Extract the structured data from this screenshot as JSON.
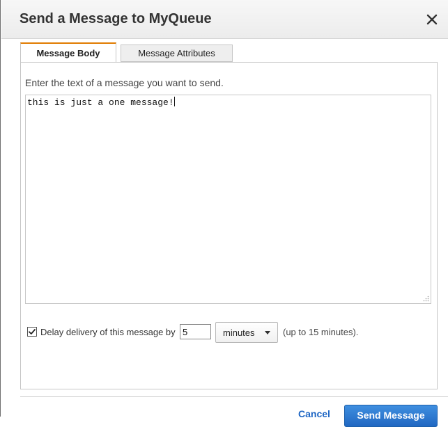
{
  "dialog": {
    "title": "Send a Message to MyQueue",
    "close_icon": "close-icon"
  },
  "tabs": [
    {
      "label": "Message Body",
      "active": true
    },
    {
      "label": "Message Attributes",
      "active": false
    }
  ],
  "body": {
    "instructions": "Enter the text of a message you want to send.",
    "message_text": "this is just a one message!"
  },
  "delay": {
    "checked": true,
    "label": "Delay delivery of this message by",
    "value": "5",
    "unit": "minutes",
    "hint": "(up to 15 minutes)."
  },
  "footer": {
    "cancel_label": "Cancel",
    "send_label": "Send Message"
  },
  "colors": {
    "accent_tab": "#e07b00",
    "primary_button": "#2067c2",
    "link": "#1e66c4"
  }
}
